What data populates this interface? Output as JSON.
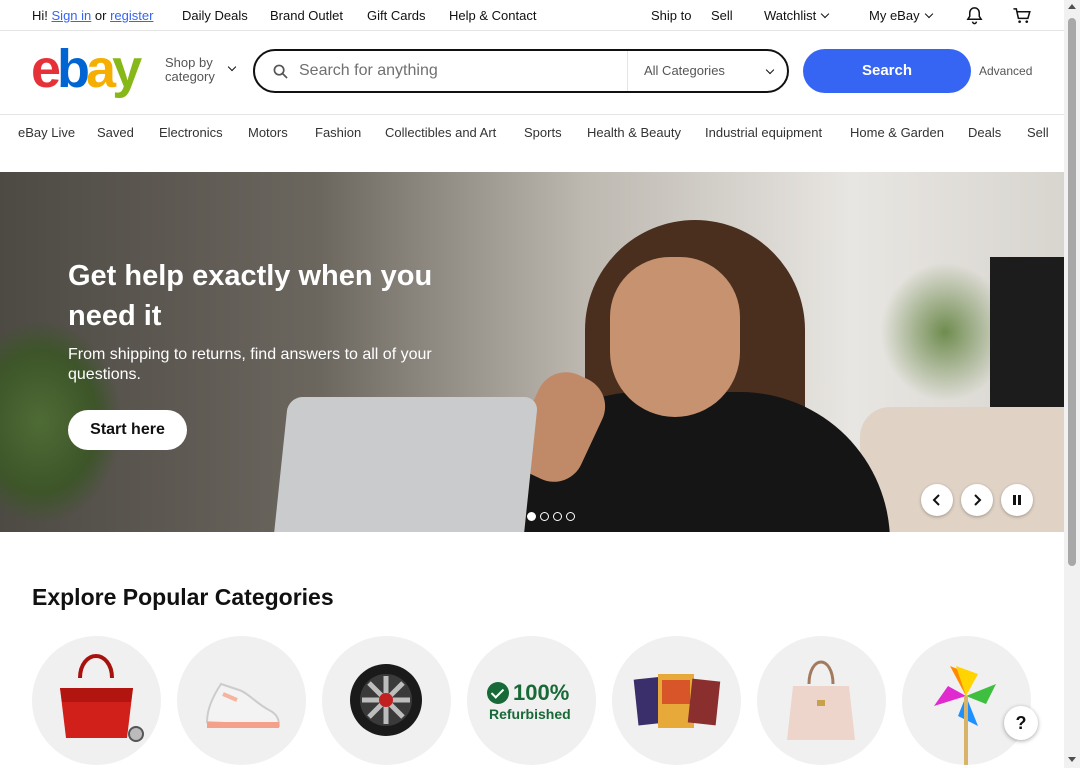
{
  "topbar": {
    "greeting_prefix": "Hi!",
    "sign_in": "Sign in",
    "or": "or",
    "register": "register",
    "links": [
      "Daily Deals",
      "Brand Outlet",
      "Gift Cards",
      "Help & Contact"
    ],
    "ship_to": "Ship to",
    "sell": "Sell",
    "watchlist": "Watchlist",
    "my_ebay": "My eBay"
  },
  "header": {
    "logo": {
      "e": "e",
      "b": "b",
      "a": "a",
      "y": "y"
    },
    "shop_by_line1": "Shop by",
    "shop_by_line2": "category",
    "search_placeholder": "Search for anything",
    "category_select": "All Categories",
    "search_button": "Search",
    "advanced": "Advanced"
  },
  "nav": [
    "eBay Live",
    "Saved",
    "Electronics",
    "Motors",
    "Fashion",
    "Collectibles and Art",
    "Sports",
    "Health & Beauty",
    "Industrial equipment",
    "Home & Garden",
    "Deals",
    "Sell"
  ],
  "hero": {
    "title": "Get help exactly when you need it",
    "subtitle": "From shipping to returns, find answers to all of your questions.",
    "button": "Start here",
    "slide_count": 4,
    "active_slide": 1
  },
  "categories": {
    "title": "Explore Popular Categories",
    "items": [
      {
        "icon": "red-handbag-icon"
      },
      {
        "icon": "sneaker-icon"
      },
      {
        "icon": "car-wheel-icon"
      },
      {
        "icon": "refurbished-badge-icon",
        "badge_pct": "100%",
        "badge_label": "Refurbished"
      },
      {
        "icon": "trading-cards-icon"
      },
      {
        "icon": "tote-bag-icon"
      },
      {
        "icon": "pinwheel-icon"
      }
    ]
  },
  "help_button": "?",
  "colors": {
    "accent": "#3665f3",
    "refurb_green": "#186938"
  }
}
